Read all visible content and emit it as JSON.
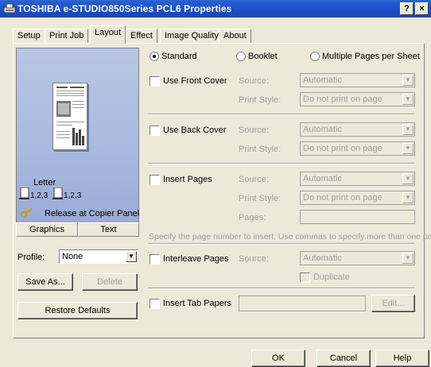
{
  "window": {
    "title": "TOSHIBA e-STUDIO850Series PCL6 Properties",
    "help_btn": "?",
    "close_btn": "×"
  },
  "tabs": [
    "Setup",
    "Print Job",
    "Layout",
    "Effect",
    "Image Quality",
    "About"
  ],
  "active_tab": "Layout",
  "preview": {
    "paper": "Letter",
    "copy_order_1": "1,2,3",
    "copy_order_2": "1,2,3",
    "release": "Release at Copier Panel"
  },
  "subtabs": [
    "Graphics",
    "Text"
  ],
  "profile": {
    "label": "Profile:",
    "value": "None"
  },
  "left_buttons": {
    "save_as": "Save As...",
    "delete": "Delete",
    "restore": "Restore Defaults"
  },
  "layout_modes": {
    "selected": "Standard",
    "options": [
      "Standard",
      "Booklet",
      "Multiple Pages per Sheet"
    ]
  },
  "front_cover": {
    "label": "Use Front Cover",
    "source_label": "Source:",
    "source_value": "Automatic",
    "style_label": "Print Style:",
    "style_value": "Do not print on page"
  },
  "back_cover": {
    "label": "Use Back Cover",
    "source_label": "Source:",
    "source_value": "Automatic",
    "style_label": "Print Style:",
    "style_value": "Do not print on page"
  },
  "insert_pages": {
    "label": "Insert Pages",
    "source_label": "Source:",
    "source_value": "Automatic",
    "style_label": "Print Style:",
    "style_value": "Do not print on page",
    "pages_label": "Pages:",
    "pages_value": "",
    "hint": "Specify the page number to insert. Use commas to specify more than one page."
  },
  "interleave": {
    "label": "Interleave Pages",
    "source_label": "Source:",
    "source_value": "Automatic",
    "duplicate_label": "Duplicate"
  },
  "tab_papers": {
    "label": "Insert Tab Papers",
    "value": "",
    "edit_btn": "Edit..."
  },
  "footer": {
    "ok": "OK",
    "cancel": "Cancel",
    "help": "Help"
  }
}
